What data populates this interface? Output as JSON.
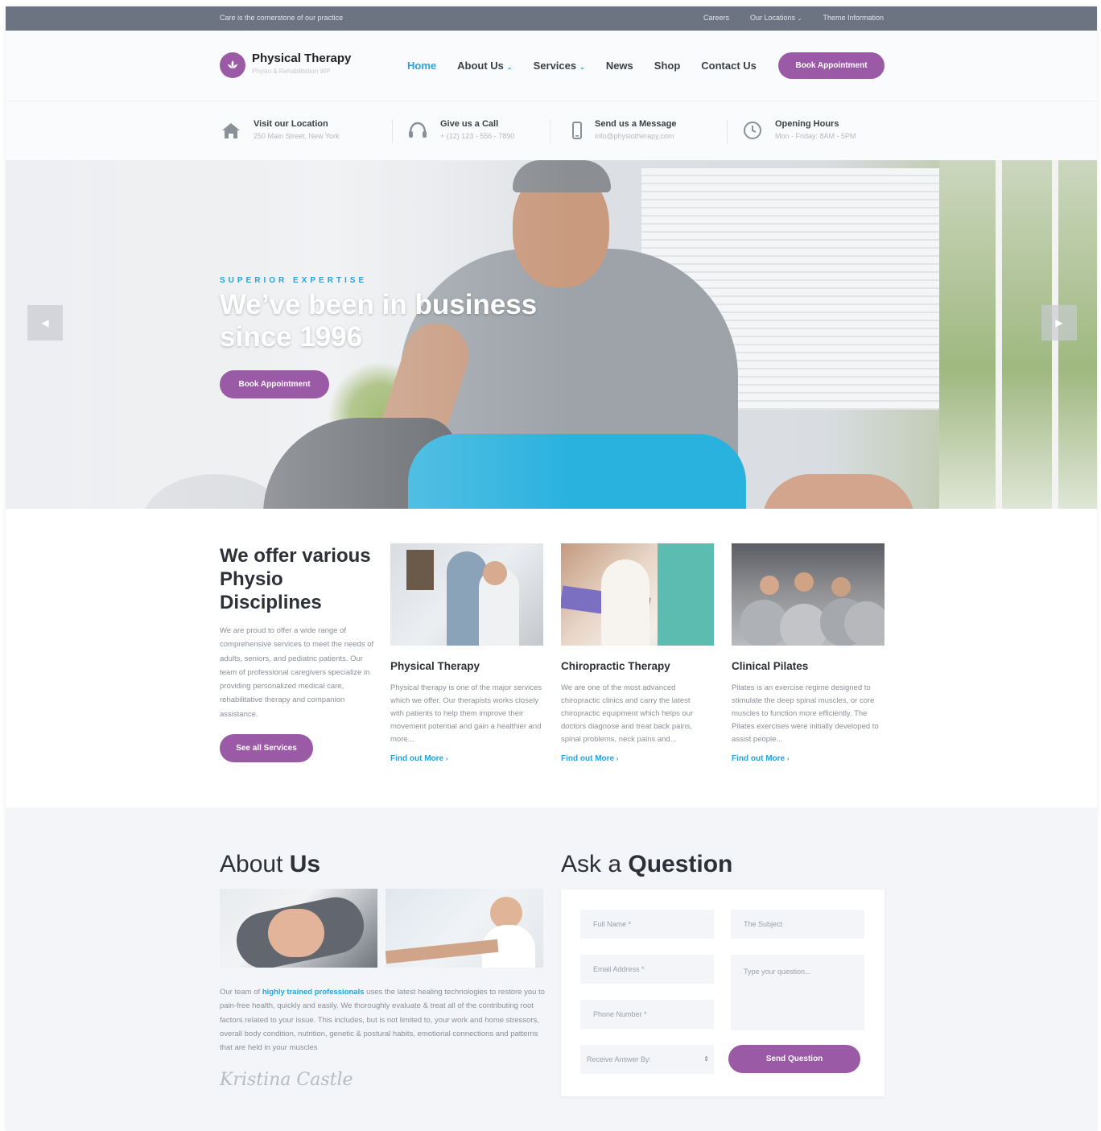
{
  "topbar": {
    "tagline": "Care is the cornerstone of our practice",
    "links": [
      "Careers",
      "Our Locations",
      "Theme Information"
    ]
  },
  "brand": {
    "title": "Physical Therapy",
    "subtitle": "Physio & Rehabilitation WP",
    "accent": "#9b5aa5",
    "link_color": "#2aa1d9"
  },
  "nav": {
    "home": "Home",
    "about": "About Us",
    "services": "Services",
    "news": "News",
    "shop": "Shop",
    "contact": "Contact Us",
    "book": "Book Appointment"
  },
  "info": [
    {
      "title": "Visit our Location",
      "detail": "250 Main Street, New York",
      "icon": "home-icon"
    },
    {
      "title": "Give us a Call",
      "detail": "+ (12) 123 - 556 - 7890",
      "icon": "headset-icon"
    },
    {
      "title": "Send us a Message",
      "detail": "info@physiotherapy.com",
      "icon": "phone-icon"
    },
    {
      "title": "Opening Hours",
      "detail": "Mon - Friday: 8AM - 5PM",
      "icon": "clock-icon"
    }
  ],
  "hero": {
    "kicker": "SUPERIOR EXPERTISE",
    "headline": "We’ve been in business since 1996",
    "button": "Book Appointment"
  },
  "services": {
    "title": "We offer various Physio Disciplines",
    "intro": "We are proud to offer a wide range of comprehensive services to meet the needs of adults, seniors, and pediatric patients. Our team of professional caregivers specialize in providing personalized medical care, rehabilitative therapy and companion assistance.",
    "button": "See all Services",
    "cards": [
      {
        "title": "Physical Therapy",
        "text": "Physical therapy is one of the major services which we offer. Our therapists works closely with patients to help them improve their movement potential and gain a healthier and more...",
        "more": "Find out More"
      },
      {
        "title": "Chiropractic Therapy",
        "text": "We are one of the most advanced chiropractic clinics and carry the latest chiropractic equipment which helps our doctors diagnose and treat back pains, spinal problems, neck pains and...",
        "more": "Find out More"
      },
      {
        "title": "Clinical Pilates",
        "text": "Pilates is an exercise regime designed to stimulate the deep spinal muscles, or core muscles to function more efficiently. The Pilates exercises were initially developed to assist people...",
        "more": "Find out More"
      }
    ]
  },
  "about": {
    "title_light": "About",
    "title_bold": "Us",
    "text_before": "Our team of",
    "text_highlight": "highly trained professionals",
    "text_after": "uses the latest healing technologies to restore you to pain-free health, quickly and easily. We thoroughly evaluate & treat all of the contributing root factors related to your issue. This includes, but is not limited to, your work and home stressors, overall body condition, nutrition, genetic & postural habits, emotional connections and patterns that are held in your muscles",
    "signature": "Kristina Castle"
  },
  "ask": {
    "title_light": "Ask a",
    "title_bold": "Question",
    "full_name": "Full Name *",
    "subject": "The Subject",
    "email": "Email Address *",
    "question": "Type your question...",
    "phone": "Phone Number *",
    "receive": "Receive Answer By:",
    "send": "Send Question"
  }
}
